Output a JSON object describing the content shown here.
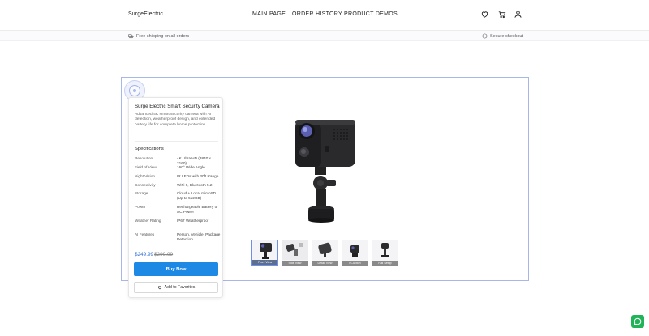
{
  "header": {
    "brand": "SurgeElectric",
    "nav": [
      "MAIN PAGE",
      "ORDER HISTORY",
      "PRODUCT DEMOS"
    ],
    "icons": [
      "heart-icon",
      "cart-icon",
      "user-icon"
    ]
  },
  "infobar": {
    "shipping": "Free shipping on all orders",
    "secure": "Secure checkout"
  },
  "product": {
    "title": "Surge Electric Smart Security Camera",
    "description": "Advanced 4K smart security camera with AI detection, weatherproof design, and extended battery life for complete home protection.",
    "specs_heading": "Specifications",
    "specs": [
      {
        "key": "Resolution",
        "value": "4K Ultra HD (3840 x 2160)"
      },
      {
        "key": "Field of View",
        "value": "160° Wide Angle"
      },
      {
        "key": "Night Vision",
        "value": "IR LEDs with 30ft Range"
      },
      {
        "key": "Connectivity",
        "value": "WiFi 6, Bluetooth 5.2"
      },
      {
        "key": "Storage",
        "value": "Cloud + Local microSD (Up to 512GB)"
      },
      {
        "key": "Power",
        "value": "Rechargeable Battery or AC Power"
      },
      {
        "key": "Weather Rating",
        "value": "IP67 Weatherproof"
      },
      {
        "key": "AI Features",
        "value": "Person, Vehicle, Package Detection"
      }
    ],
    "price": "$249.99",
    "old_price": "$299.99",
    "buy_label": "Buy Now",
    "favorite_label": "Add to Favorites"
  },
  "thumbnails": [
    {
      "label": "Front View",
      "active": true
    },
    {
      "label": "Side View",
      "active": false
    },
    {
      "label": "Detail View",
      "active": false
    },
    {
      "label": "In-Action",
      "active": false
    },
    {
      "label": "Full Setup",
      "active": false
    }
  ],
  "colors": {
    "accent": "#1e88e5",
    "price": "#2f6fd6",
    "frame": "#a9b6ea",
    "chat": "#21b357"
  }
}
